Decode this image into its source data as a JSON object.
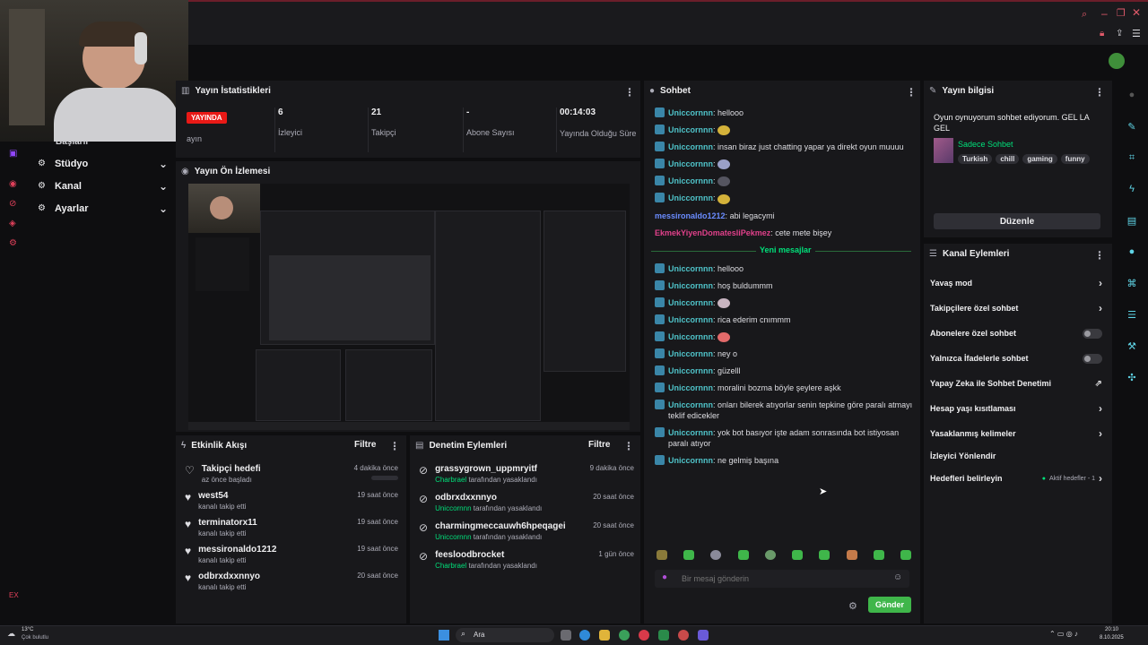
{
  "sidebar": {
    "top_item": "Başlarıl",
    "items": [
      {
        "label": "Stüdyo",
        "icon": "studio-icon"
      },
      {
        "label": "Kanal",
        "icon": "channel-icon"
      },
      {
        "label": "Ayarlar",
        "icon": "settings-gear-icon"
      }
    ],
    "webcam_label": "YAYINDA"
  },
  "stats": {
    "title": "Yayın İstatistikleri",
    "live_badge": "YAYINDA",
    "live_sub": "ayın",
    "cells": [
      {
        "value": "6",
        "label": "İzleyici"
      },
      {
        "value": "21",
        "label": "Takipçi"
      },
      {
        "value": "-",
        "label": "Abone Sayısı"
      },
      {
        "value": "00:14:03",
        "label": "Yayında Olduğu Süre"
      }
    ]
  },
  "preview": {
    "title": "Yayın Ön İzlemesi"
  },
  "activity": {
    "title": "Etkinlik Akışı",
    "filter": "Filtre",
    "items": [
      {
        "name": "Takipçi hedefi",
        "sub": "az önce başladı",
        "time": "4 dakika önce"
      },
      {
        "name": "west54",
        "sub": "kanalı takip etti",
        "time": "19 saat önce"
      },
      {
        "name": "terminatorx11",
        "sub": "kanalı takip etti",
        "time": "19 saat önce"
      },
      {
        "name": "messironaldo1212",
        "sub": "kanalı takip etti",
        "time": "19 saat önce"
      },
      {
        "name": "odbrxdxxnnyo",
        "sub": "kanalı takip etti",
        "time": "20 saat önce"
      }
    ]
  },
  "moderation": {
    "title": "Denetim Eylemleri",
    "filter": "Filtre",
    "items": [
      {
        "name": "grassygrown_uppmryitf",
        "by": "Charbrael",
        "suffix": "tarafından yasaklandı",
        "time": "9 dakika önce"
      },
      {
        "name": "odbrxdxxnnyo",
        "by": "Uniccornnn",
        "suffix": "tarafından yasaklandı",
        "time": "20 saat önce"
      },
      {
        "name": "charmingmeccauwh6hpeqagei",
        "by": "Uniccornnn",
        "suffix": "tarafından yasaklandı",
        "time": "20 saat önce"
      },
      {
        "name": "feesloodbrocket",
        "by": "Charbrael",
        "suffix": "tarafından yasaklandı",
        "time": "1 gün önce"
      }
    ]
  },
  "chat": {
    "title": "Sohbet",
    "new_messages": "Yeni mesajlar",
    "before": [
      {
        "user": "Uniccornnn",
        "color": "#4fc3c9",
        "badge": true,
        "text": "hellooo",
        "emote": ""
      },
      {
        "user": "Uniccornnn",
        "color": "#4fc3c9",
        "badge": true,
        "text": "",
        "emote": "#d4b23a"
      },
      {
        "user": "Uniccornnn",
        "color": "#4fc3c9",
        "badge": true,
        "text": "insan biraz just chatting yapar ya direkt oyun muuuu",
        "emote": ""
      },
      {
        "user": "Uniccornnn",
        "color": "#4fc3c9",
        "badge": true,
        "text": "",
        "emote": "#9aa0c8"
      },
      {
        "user": "Uniccornnn",
        "color": "#4fc3c9",
        "badge": true,
        "text": "",
        "emote": "#555560"
      },
      {
        "user": "Uniccornnn",
        "color": "#4fc3c9",
        "badge": true,
        "text": "",
        "emote": "#d4b23a"
      },
      {
        "user": "messironaldo1212",
        "color": "#6a8cff",
        "badge": false,
        "text": "abi legacymi",
        "emote": ""
      },
      {
        "user": "EkmekYiyenDomatesliPekmez",
        "color": "#e0408a",
        "badge": false,
        "text": "cete mete bişey",
        "emote": ""
      }
    ],
    "after": [
      {
        "user": "Uniccornnn",
        "text": "hellooo",
        "emote": ""
      },
      {
        "user": "Uniccornnn",
        "text": "hoş buldummm",
        "emote": ""
      },
      {
        "user": "Uniccornnn",
        "text": "",
        "emote": "#c8b4c0"
      },
      {
        "user": "Uniccornnn",
        "text": "rica ederim cnımmm",
        "emote": ""
      },
      {
        "user": "Uniccornnn",
        "text": "",
        "emote": "#e26a6a"
      },
      {
        "user": "Uniccornnn",
        "text": "ney o",
        "emote": ""
      },
      {
        "user": "Uniccornnn",
        "text": "güzelll",
        "emote": ""
      },
      {
        "user": "Uniccornnn",
        "text": "moralini bozma böyle şeylere aşkk",
        "emote": ""
      },
      {
        "user": "Uniccornnn",
        "text": "onları bilerek atıyorlar senin tepkine göre paralı atmayı teklif edicekler",
        "emote": ""
      },
      {
        "user": "Uniccornnn",
        "text": "yok bot basıyor işte adam sonrasında bot istiyosan paralı atıyor",
        "emote": ""
      },
      {
        "user": "Uniccornnn",
        "text": "ne gelmiş başına",
        "emote": ""
      }
    ],
    "input_placeholder": "Bir mesaj gönderin",
    "send_label": "Gönder"
  },
  "stream_info": {
    "title": "Yayın bilgisi",
    "description": "Oyun oynuyorum sohbet ediyorum. GEL LA GEL",
    "category": "Sadece Sohbet",
    "tags": [
      "Turkish",
      "chill",
      "gaming",
      "funny"
    ],
    "edit_label": "Düzenle"
  },
  "channel_actions": {
    "title": "Kanal Eylemleri",
    "items": [
      {
        "label": "Yavaş mod",
        "control": "chevron"
      },
      {
        "label": "Takipçilere özel sohbet",
        "control": "chevron"
      },
      {
        "label": "Abonelere özel sohbet",
        "control": "toggle"
      },
      {
        "label": "Yalnızca İfadelerle sohbet",
        "control": "toggle"
      },
      {
        "label": "Yapay Zeka ile Sohbet Denetimi",
        "control": "external"
      },
      {
        "label": "Hesap yaşı kısıtlaması",
        "control": "chevron"
      },
      {
        "label": "Yasaklanmış kelimeler",
        "control": "chevron"
      },
      {
        "label": "İzleyici Yönlendir",
        "control": "none"
      },
      {
        "label": "Hedefleri belirleyin",
        "control": "chevron",
        "extra": "Aktif hedefler - 1"
      }
    ]
  },
  "taskbar": {
    "weather": "13°C",
    "weather_sub": "Çok bulutlu",
    "search": "Ara",
    "time": "20:10",
    "date": "8.10.2025"
  },
  "colors": {
    "accent": "#53fc18",
    "cyan": "#5fd4e6",
    "live": "#e91916"
  }
}
